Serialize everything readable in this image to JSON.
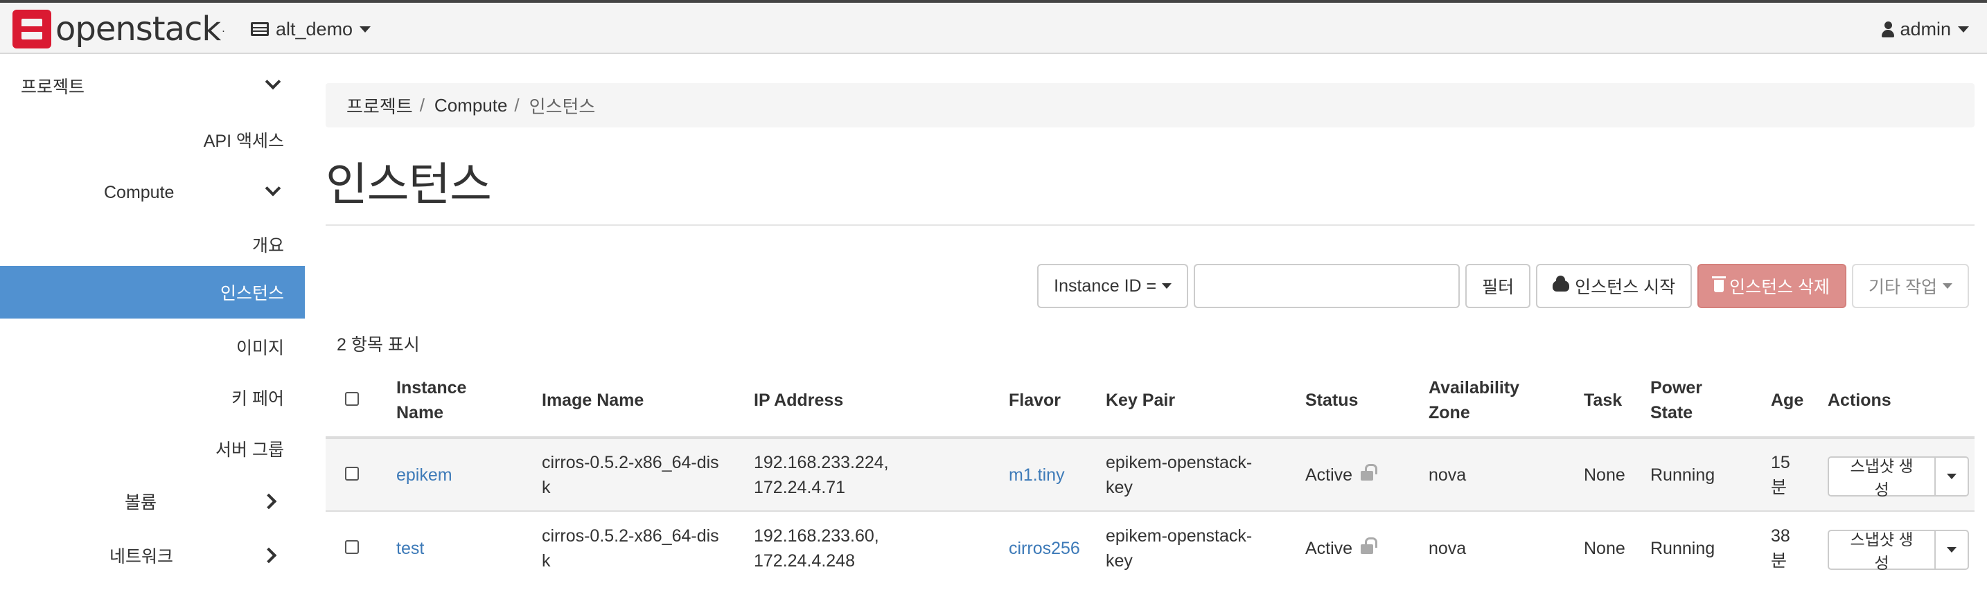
{
  "header": {
    "logo_text": "openstack",
    "logo_mark": ".",
    "project": "alt_demo",
    "user": "admin"
  },
  "sidebar": {
    "items": [
      {
        "label": "프로젝트"
      },
      {
        "label": "API 액세스"
      },
      {
        "label": "Compute"
      },
      {
        "label": "개요"
      },
      {
        "label": "인스턴스"
      },
      {
        "label": "이미지"
      },
      {
        "label": "키 페어"
      },
      {
        "label": "서버 그룹"
      },
      {
        "label": "볼륨"
      },
      {
        "label": "네트워크"
      }
    ]
  },
  "breadcrumb": {
    "items": [
      "프로젝트",
      "Compute",
      "인스턴스"
    ],
    "separator": "/"
  },
  "page": {
    "title": "인스턴스",
    "count_text": "2 항목 표시"
  },
  "toolbar": {
    "filter_field": "Instance ID =",
    "filter_value": "",
    "filter_button": "필터",
    "launch_button": "인스턴스 시작",
    "delete_button": "인스턴스 삭제",
    "more_actions": "기타 작업"
  },
  "table": {
    "headers": {
      "name": [
        "Instance",
        "Name"
      ],
      "image": "Image Name",
      "ip": "IP Address",
      "flavor": "Flavor",
      "keypair": "Key Pair",
      "status": "Status",
      "az": [
        "Availability",
        "Zone"
      ],
      "task": "Task",
      "power": [
        "Power",
        "State"
      ],
      "age": "Age",
      "actions": "Actions"
    },
    "rows": [
      {
        "name": "epikem",
        "image": [
          "cirros-0.5.2-x86_64-dis",
          "k"
        ],
        "ip": [
          "192.168.233.224,",
          "172.24.4.71"
        ],
        "flavor": "m1.tiny",
        "keypair": [
          "epikem-openstack-",
          "key"
        ],
        "status": "Active",
        "az": "nova",
        "task": "None",
        "power": "Running",
        "age": [
          "15",
          "분"
        ],
        "action": "스냅샷 생성"
      },
      {
        "name": "test",
        "image": [
          "cirros-0.5.2-x86_64-dis",
          "k"
        ],
        "ip": [
          "192.168.233.60,",
          "172.24.4.248"
        ],
        "flavor": "cirros256",
        "keypair": [
          "epikem-openstack-",
          "key"
        ],
        "status": "Active",
        "az": "nova",
        "task": "None",
        "power": "Running",
        "age": [
          "38",
          "분"
        ],
        "action": "스냅샷 생성"
      }
    ]
  },
  "colors": {
    "active_nav": "#5191d0",
    "link": "#3d7ab8",
    "danger": "#dd8f8c",
    "brand": "#da1a32"
  }
}
